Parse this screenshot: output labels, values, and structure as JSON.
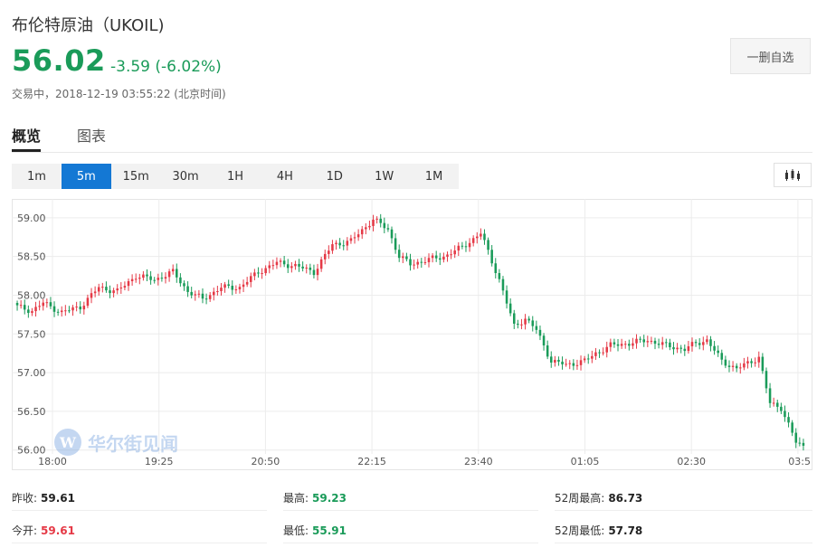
{
  "header": {
    "title": "布伦特原油（UKOIL)",
    "price": "56.02",
    "change": "-3.59 (-6.02%)",
    "timestamp": "交易中，2018-12-19 03:55:22 (北京时间)",
    "watch_button": "一删自选"
  },
  "tabs": [
    "概览",
    "图表"
  ],
  "periods": [
    "1m",
    "5m",
    "15m",
    "30m",
    "1H",
    "4H",
    "1D",
    "1W",
    "1M"
  ],
  "active_period": "5m",
  "icons": {
    "candle_button": "candlestick-chart-icon"
  },
  "watermark": "华尔街见闻",
  "chart_data": {
    "type": "candlestick",
    "x_ticks": [
      "18:00",
      "19:25",
      "20:50",
      "22:15",
      "23:40",
      "01:05",
      "02:30",
      "03:5"
    ],
    "y_ticks": [
      "59.00",
      "58.50",
      "58.00",
      "57.50",
      "57.00",
      "56.50",
      "56.00"
    ],
    "ylim": [
      55.95,
      59.15
    ],
    "colors": {
      "up": "#e53946",
      "down": "#1a9b59",
      "grid": "#ececec",
      "axis_text": "#555555"
    },
    "anchors": [
      [
        0,
        57.85
      ],
      [
        4,
        57.8
      ],
      [
        7,
        57.9
      ],
      [
        12,
        57.78
      ],
      [
        17,
        57.85
      ],
      [
        22,
        58.1
      ],
      [
        27,
        58.05
      ],
      [
        32,
        58.25
      ],
      [
        37,
        58.2
      ],
      [
        42,
        58.3
      ],
      [
        46,
        58.05
      ],
      [
        50,
        57.95
      ],
      [
        55,
        58.1
      ],
      [
        60,
        58.1
      ],
      [
        65,
        58.3
      ],
      [
        70,
        58.42
      ],
      [
        75,
        58.38
      ],
      [
        80,
        58.3
      ],
      [
        85,
        58.65
      ],
      [
        90,
        58.7
      ],
      [
        96,
        58.98
      ],
      [
        100,
        58.85
      ],
      [
        103,
        58.5
      ],
      [
        106,
        58.4
      ],
      [
        110,
        58.45
      ],
      [
        115,
        58.5
      ],
      [
        120,
        58.62
      ],
      [
        125,
        58.8
      ],
      [
        130,
        58.2
      ],
      [
        134,
        57.6
      ],
      [
        137,
        57.7
      ],
      [
        140,
        57.55
      ],
      [
        144,
        57.15
      ],
      [
        148,
        57.1
      ],
      [
        153,
        57.15
      ],
      [
        156,
        57.25
      ],
      [
        160,
        57.35
      ],
      [
        165,
        57.38
      ],
      [
        170,
        57.42
      ],
      [
        175,
        57.35
      ],
      [
        180,
        57.3
      ],
      [
        183,
        57.38
      ],
      [
        186,
        57.42
      ],
      [
        190,
        57.15
      ],
      [
        194,
        57.05
      ],
      [
        197,
        57.12
      ],
      [
        200,
        57.2
      ],
      [
        203,
        56.6
      ],
      [
        206,
        56.55
      ],
      [
        210,
        56.1
      ],
      [
        212,
        56.05
      ]
    ]
  },
  "stats": [
    {
      "label": "昨收:",
      "value": "59.61",
      "color": "dark"
    },
    {
      "label": "最高:",
      "value": "59.23",
      "color": "green"
    },
    {
      "label": "52周最高:",
      "value": "86.73",
      "color": "dark"
    },
    {
      "label": "今开:",
      "value": "59.61",
      "color": "red"
    },
    {
      "label": "最低:",
      "value": "55.91",
      "color": "green"
    },
    {
      "label": "52周最低:",
      "value": "57.78",
      "color": "dark"
    }
  ]
}
